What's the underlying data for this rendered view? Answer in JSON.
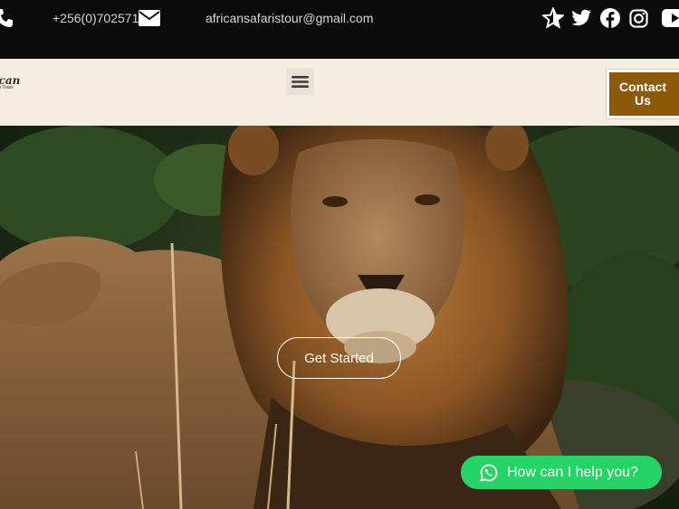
{
  "topbar": {
    "phone": "+256(0)702571",
    "email": "africansafaristour@gmail.com",
    "icons": [
      "phone-icon",
      "envelope-icon",
      "star-icon",
      "twitter-icon",
      "facebook-icon",
      "instagram-icon",
      "youtube-icon"
    ]
  },
  "header": {
    "logo_text": "ican",
    "logo_subtext": "i Tours",
    "menu_icon": "hamburger-icon",
    "contact_label": "Contact Us"
  },
  "hero": {
    "button_label": "Get Started",
    "image": "lion-photo"
  },
  "chat": {
    "label": "How can I help you?",
    "icon": "whatsapp-icon",
    "color": "#25d366"
  },
  "colors": {
    "topbar_bg": "#0b0b0b",
    "header_bg": "#f5ede0",
    "contact_bg": "#8b5a07"
  }
}
